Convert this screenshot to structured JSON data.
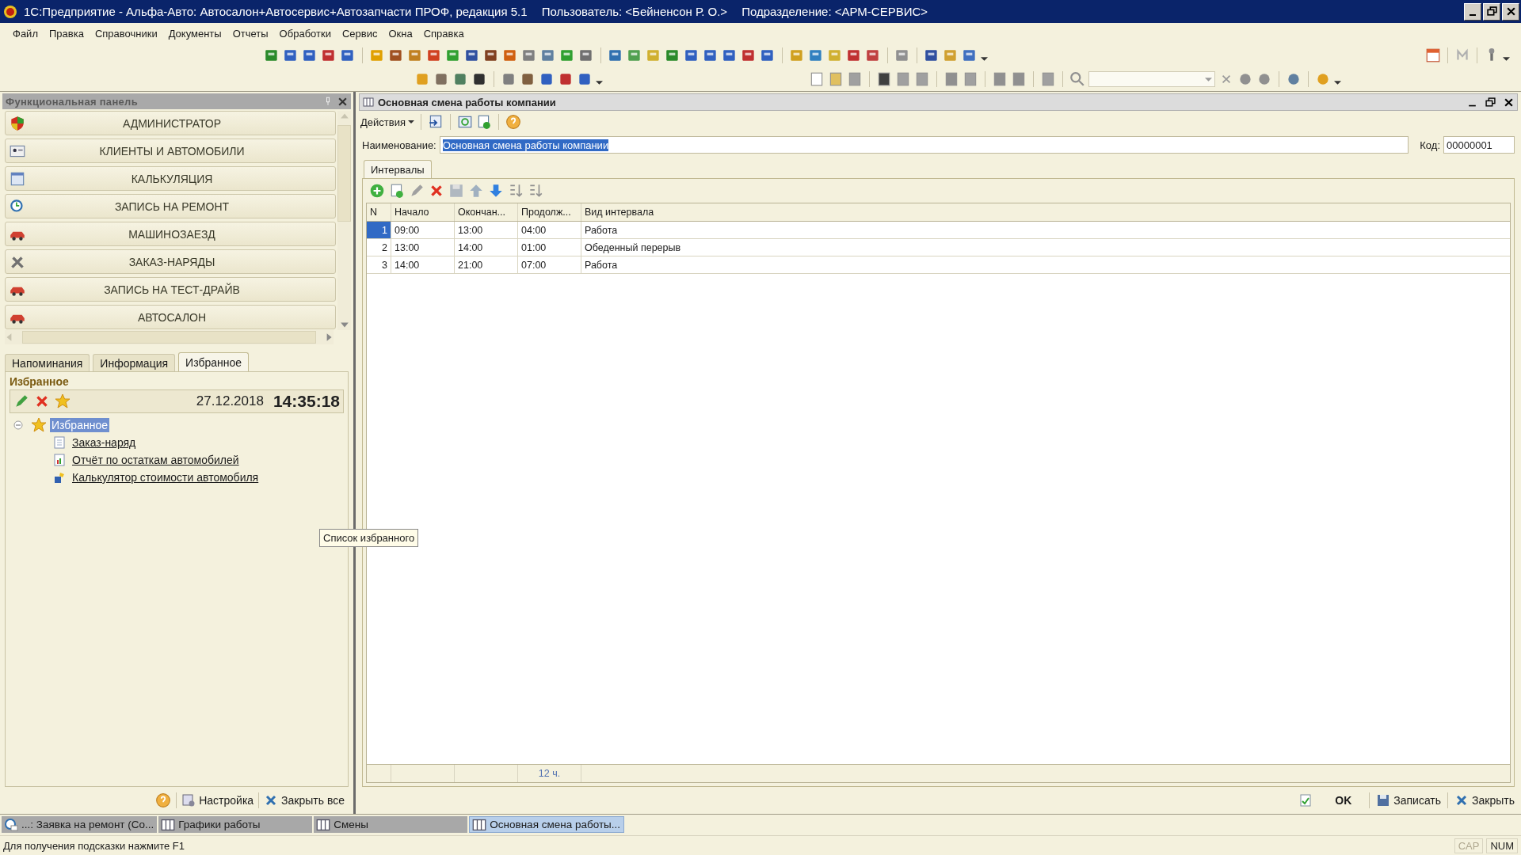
{
  "window": {
    "title": "1С:Предприятие - Альфа-Авто: Автосалон+Автосервис+Автозапчасти ПРОФ, редакция 5.1",
    "user": "Пользователь: <Бейненсон Р. О.>",
    "division": "Подразделение: <АРМ-СЕРВИС>"
  },
  "menu": [
    "Файл",
    "Правка",
    "Справочники",
    "Документы",
    "Отчеты",
    "Обработки",
    "Сервис",
    "Окна",
    "Справка"
  ],
  "function_panel": {
    "title": "Функциональная панель",
    "items": [
      "АДМИНИСТРАТОР",
      "КЛИЕНТЫ И АВТОМОБИЛИ",
      "КАЛЬКУЛЯЦИЯ",
      "ЗАПИСЬ НА РЕМОНТ",
      "МАШИНОЗАЕЗД",
      "ЗАКАЗ-НАРЯДЫ",
      "ЗАПИСЬ НА ТЕСТ-ДРАЙВ",
      "АВТОСАЛОН"
    ],
    "tabs": [
      {
        "label": "Напоминания",
        "selected": false
      },
      {
        "label": "Информация",
        "selected": false
      },
      {
        "label": "Избранное",
        "selected": true
      }
    ],
    "favorites": {
      "heading": "Избранное",
      "date": "27.12.2018",
      "time": "14:35:18",
      "tree": [
        {
          "label": "Избранное",
          "selected": true,
          "expanded": true,
          "children": [
            {
              "label": "Заказ-наряд"
            },
            {
              "label": "Отчёт по остаткам автомобилей"
            },
            {
              "label": "Калькулятор стоимости автомобиля"
            }
          ]
        }
      ],
      "tooltip": "Список избранного"
    },
    "footer_buttons": [
      "Настройка",
      "Закрыть все"
    ]
  },
  "form": {
    "title": "Основная смена работы компании",
    "actions": "Действия",
    "name_label": "Наименование:",
    "name_value": "Основная смена работы компании",
    "name_selected": true,
    "code_label": "Код:",
    "code_value": "00000001",
    "tabs": [
      {
        "label": "Интервалы",
        "selected": true
      }
    ],
    "table": {
      "columns": [
        "N",
        "Начало",
        "Окончан...",
        "Продолж...",
        "Вид интервала"
      ],
      "rows": [
        {
          "cells": [
            "1",
            "09:00",
            "13:00",
            "04:00",
            "Работа"
          ],
          "selected": true
        },
        {
          "cells": [
            "2",
            "13:00",
            "14:00",
            "01:00",
            "Обеденный перерыв"
          ],
          "selected": false
        },
        {
          "cells": [
            "3",
            "14:00",
            "21:00",
            "07:00",
            "Работа"
          ],
          "selected": false
        }
      ],
      "total": "12 ч."
    },
    "buttons": [
      "OK",
      "Записать",
      "Закрыть"
    ]
  },
  "taskbar": [
    {
      "label": "...: Заявка на ремонт (Со...",
      "selected": false
    },
    {
      "label": "Графики работы",
      "selected": false
    },
    {
      "label": "Смены",
      "selected": false
    },
    {
      "label": "Основная смена работы...",
      "selected": true
    }
  ],
  "status_bar": {
    "hint": "Для получения подсказки нажмите F1",
    "indicators": [
      {
        "label": "CAP",
        "on": false
      },
      {
        "label": "NUM",
        "on": true
      }
    ]
  }
}
